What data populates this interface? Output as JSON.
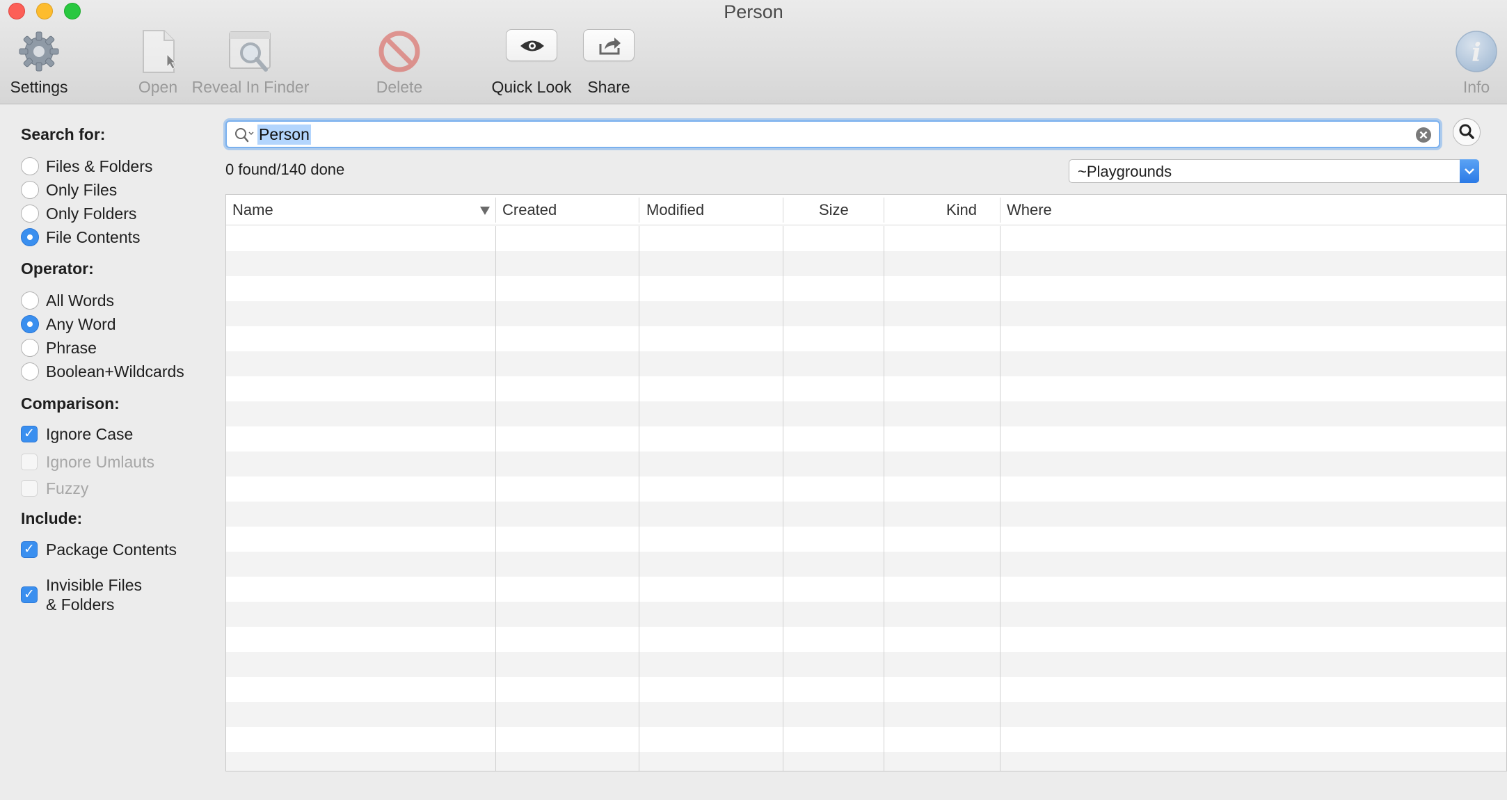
{
  "window": {
    "title": "Person"
  },
  "toolbar": {
    "settings": "Settings",
    "open": "Open",
    "reveal": "Reveal In Finder",
    "delete": "Delete",
    "quick_look": "Quick Look",
    "share": "Share",
    "info": "Info"
  },
  "sidebar": {
    "search_for": {
      "title": "Search for:",
      "options": [
        "Files & Folders",
        "Only Files",
        "Only Folders",
        "File Contents"
      ],
      "selected": "File Contents"
    },
    "operator": {
      "title": "Operator:",
      "options": [
        "All Words",
        "Any Word",
        "Phrase",
        "Boolean+Wildcards"
      ],
      "selected": "Any Word"
    },
    "comparison": {
      "title": "Comparison:",
      "ignore_case": "Ignore Case",
      "ignore_umlauts": "Ignore Umlauts",
      "fuzzy": "Fuzzy"
    },
    "include": {
      "title": "Include:",
      "package_contents": "Package Contents",
      "invisible_line1": "Invisible Files",
      "invisible_line2": "& Folders"
    }
  },
  "search": {
    "query": "Person"
  },
  "status": {
    "text": "0 found/140 done"
  },
  "location": {
    "value": "~Playgrounds"
  },
  "table": {
    "columns": [
      "Name",
      "Created",
      "Modified",
      "Size",
      "Kind",
      "Where"
    ],
    "sort_column": "Name",
    "rows": []
  },
  "colors": {
    "accent": "#3a8fef",
    "selection": "#b3d5fd"
  }
}
